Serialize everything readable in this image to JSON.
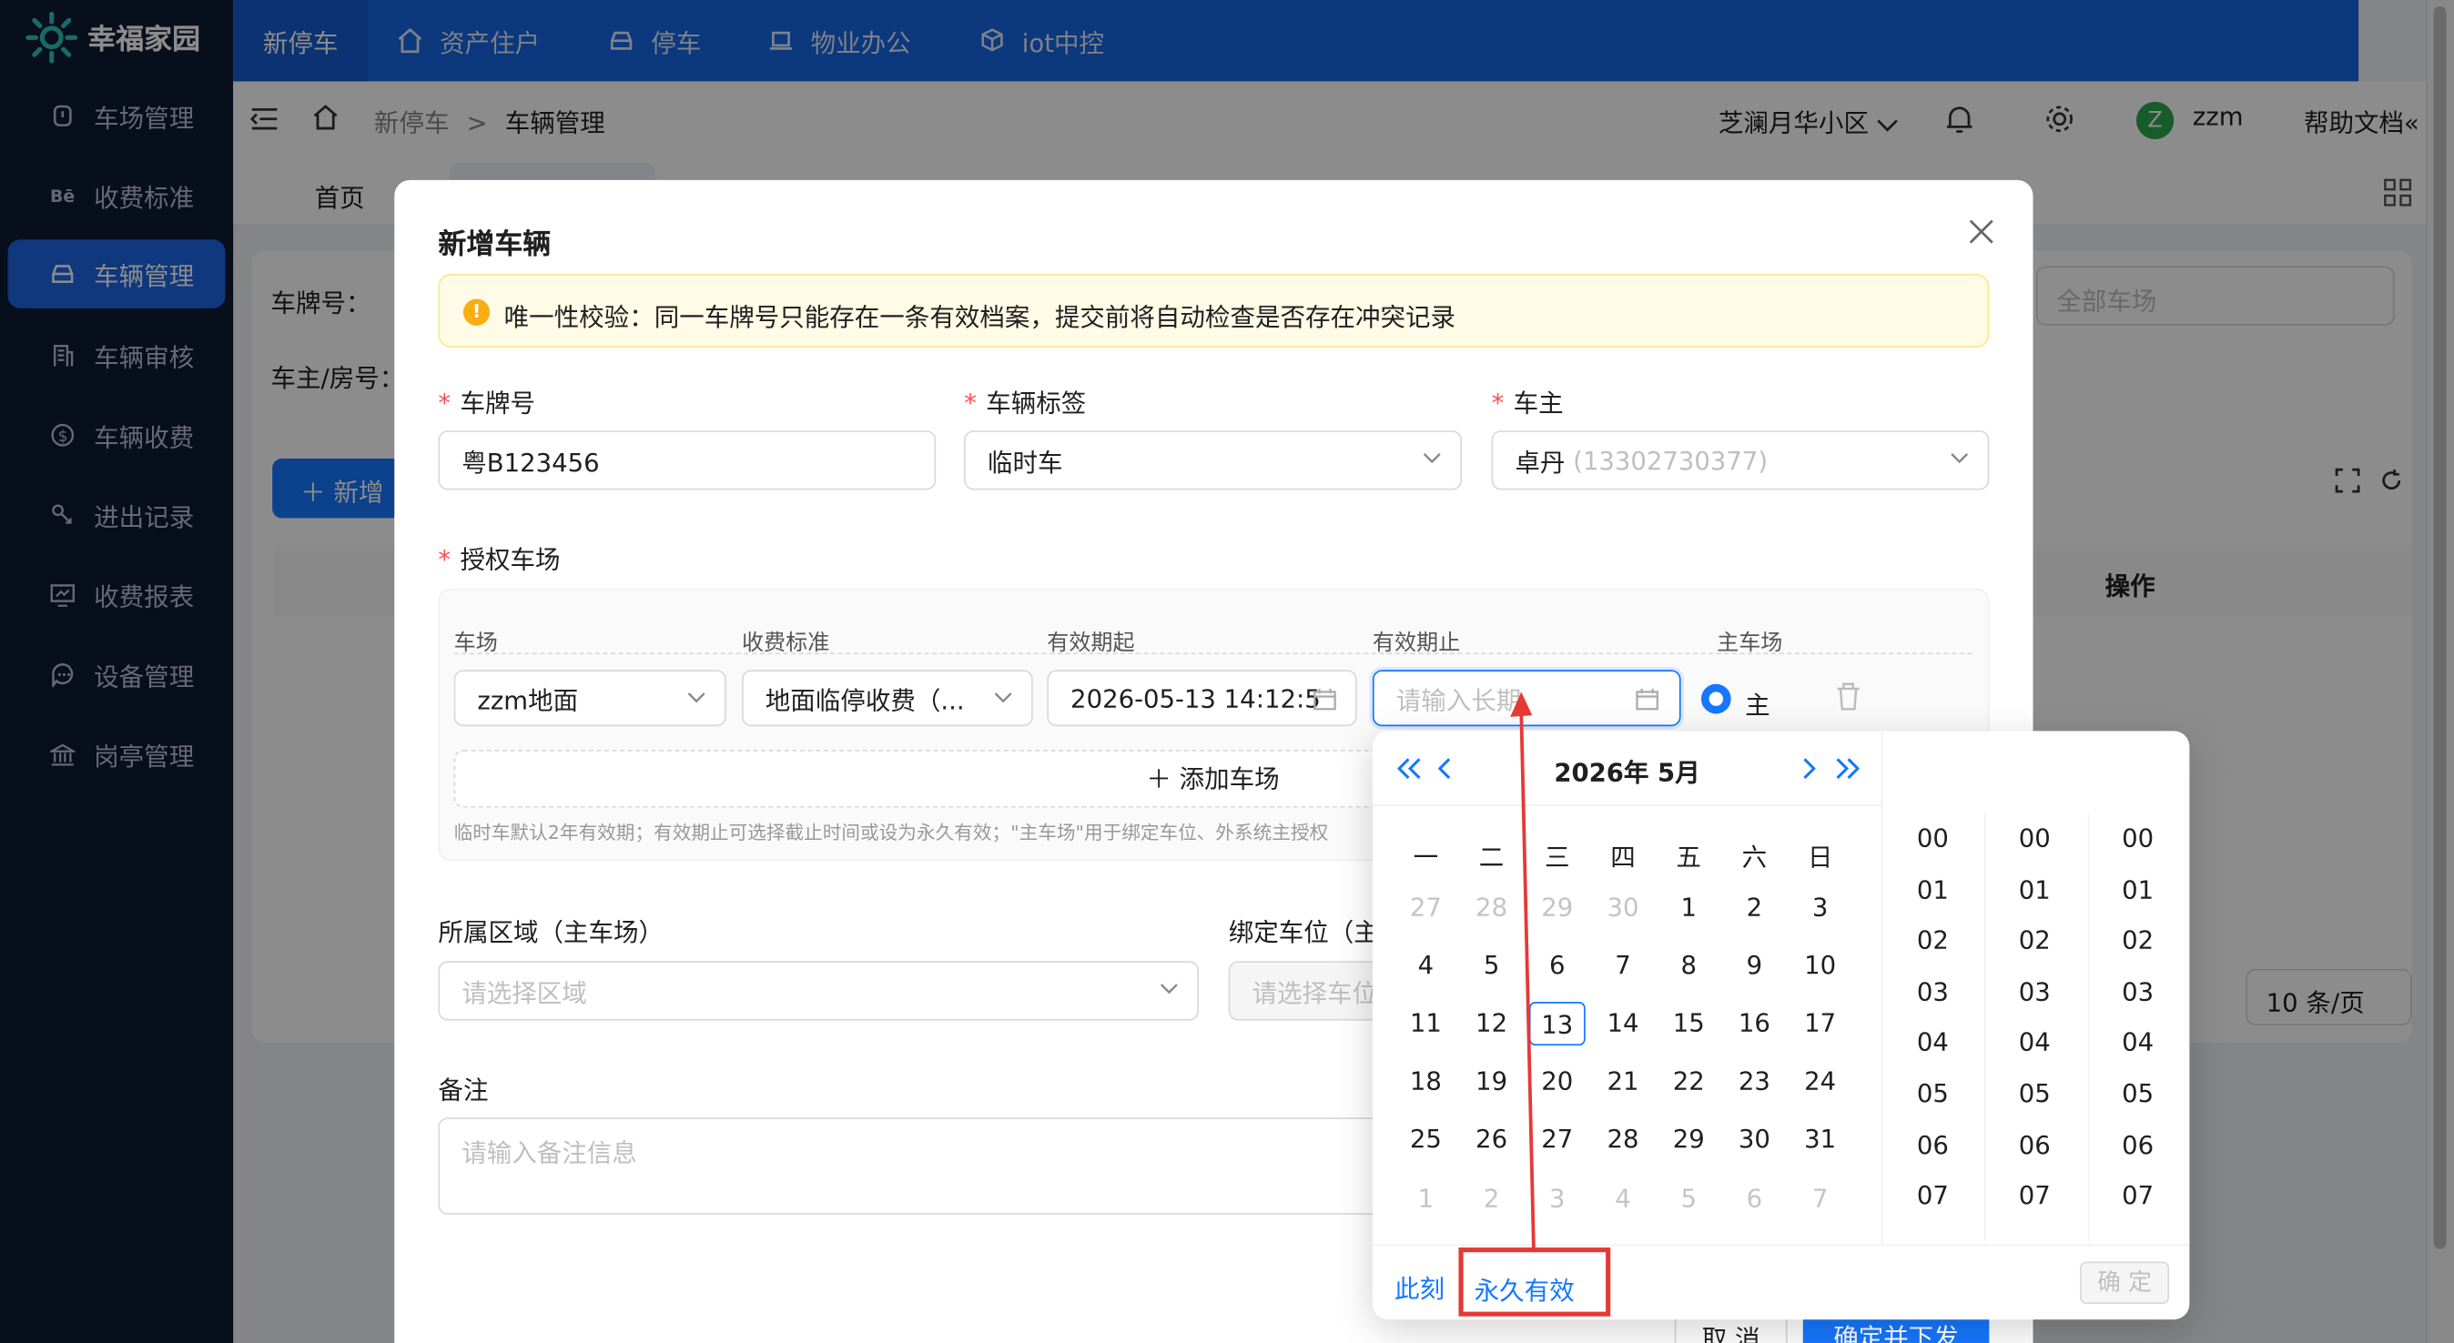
{
  "sidebar": {
    "logo_text": "幸福家园",
    "items": [
      {
        "label": "车场管理",
        "icon": "parking-lot-icon"
      },
      {
        "label": "收费标准",
        "icon": "behance-icon"
      },
      {
        "label": "车辆管理",
        "icon": "car-icon",
        "active": true
      },
      {
        "label": "车辆审核",
        "icon": "audit-building-icon"
      },
      {
        "label": "车辆收费",
        "icon": "dollar-coin-icon"
      },
      {
        "label": "进出记录",
        "icon": "record-link-icon"
      },
      {
        "label": "收费报表",
        "icon": "monitor-report-icon"
      },
      {
        "label": "设备管理",
        "icon": "chat-device-icon"
      },
      {
        "label": "岗亭管理",
        "icon": "bank-booth-icon"
      }
    ]
  },
  "topnav": {
    "tabs": [
      {
        "label": "新停车",
        "icon": ""
      },
      {
        "label": "资产住户",
        "icon": "home-icon"
      },
      {
        "label": "停车",
        "icon": "car-icon"
      },
      {
        "label": "物业办公",
        "icon": "laptop-icon"
      },
      {
        "label": "iot中控",
        "icon": "cube-icon"
      }
    ]
  },
  "header": {
    "breadcrumb_root": "新停车",
    "breadcrumb_sep": ">",
    "breadcrumb_current": "车辆管理",
    "community": "芝澜月华小区",
    "user_initial": "Z",
    "user_name": "zzm",
    "help": "帮助文档"
  },
  "background": {
    "tab_home": "首页",
    "filter_plate_label": "车牌号：",
    "filter_owner_label": "车主/房号：",
    "filter_lot_placeholder": "全部车场",
    "add_button": "新增",
    "table_action_header": "操作",
    "page_size": "10 条/页"
  },
  "modal": {
    "title": "新增车辆",
    "alert": "唯一性校验：同一车牌号只能存在一条有效档案，提交前将自动检查是否存在冲突记录",
    "plate_label": "车牌号",
    "plate_value": "粤B123456",
    "tag_label": "车辆标签",
    "tag_value": "临时车",
    "owner_label": "车主",
    "owner_name": "卓丹",
    "owner_phone": "(13302730377)",
    "auth_label": "授权车场",
    "columns": [
      "车场",
      "收费标准",
      "有效期起",
      "有效期止",
      "主车场"
    ],
    "row": {
      "lot": "zzm地面",
      "fee": "地面临停收费（...",
      "start": "2026-05-13 14:12:5",
      "end_placeholder": "请输入长期",
      "main": "主"
    },
    "add_lot": "添加车场",
    "hint": "临时车默认2年有效期；有效期止可选择截止时间或设为永久有效；\"主车场\"用于绑定车位、外系统主授权",
    "area_label": "所属区域（主车场）",
    "area_placeholder": "请选择区域",
    "spot_label": "绑定车位（主",
    "spot_placeholder": "请选择车位",
    "remark_label": "备注",
    "remark_placeholder": "请输入备注信息",
    "cancel": "取 消",
    "confirm": "确定并下发"
  },
  "calendar": {
    "year_label": "2026年",
    "month_label": "5月",
    "weekdays": [
      "一",
      "二",
      "三",
      "四",
      "五",
      "六",
      "日"
    ],
    "weeks": [
      [
        "27",
        "28",
        "29",
        "30",
        "1",
        "2",
        "3"
      ],
      [
        "4",
        "5",
        "6",
        "7",
        "8",
        "9",
        "10"
      ],
      [
        "11",
        "12",
        "13",
        "14",
        "15",
        "16",
        "17"
      ],
      [
        "18",
        "19",
        "20",
        "21",
        "22",
        "23",
        "24"
      ],
      [
        "25",
        "26",
        "27",
        "28",
        "29",
        "30",
        "31"
      ],
      [
        "1",
        "2",
        "3",
        "4",
        "5",
        "6",
        "7"
      ]
    ],
    "selected_day": "13",
    "hours": [
      "00",
      "01",
      "02",
      "03",
      "04",
      "05",
      "06",
      "07"
    ],
    "minutes": [
      "00",
      "01",
      "02",
      "03",
      "04",
      "05",
      "06",
      "07"
    ],
    "seconds": [
      "00",
      "01",
      "02",
      "03",
      "04",
      "05",
      "06",
      "07"
    ],
    "now_button": "此刻",
    "forever_button": "永久有效",
    "ok_button": "确 定"
  },
  "colors": {
    "primary": "#1677ff",
    "sidebar_bg": "#0e1b33",
    "topbar_bg": "#1766e3",
    "annotation": "#e53935"
  }
}
